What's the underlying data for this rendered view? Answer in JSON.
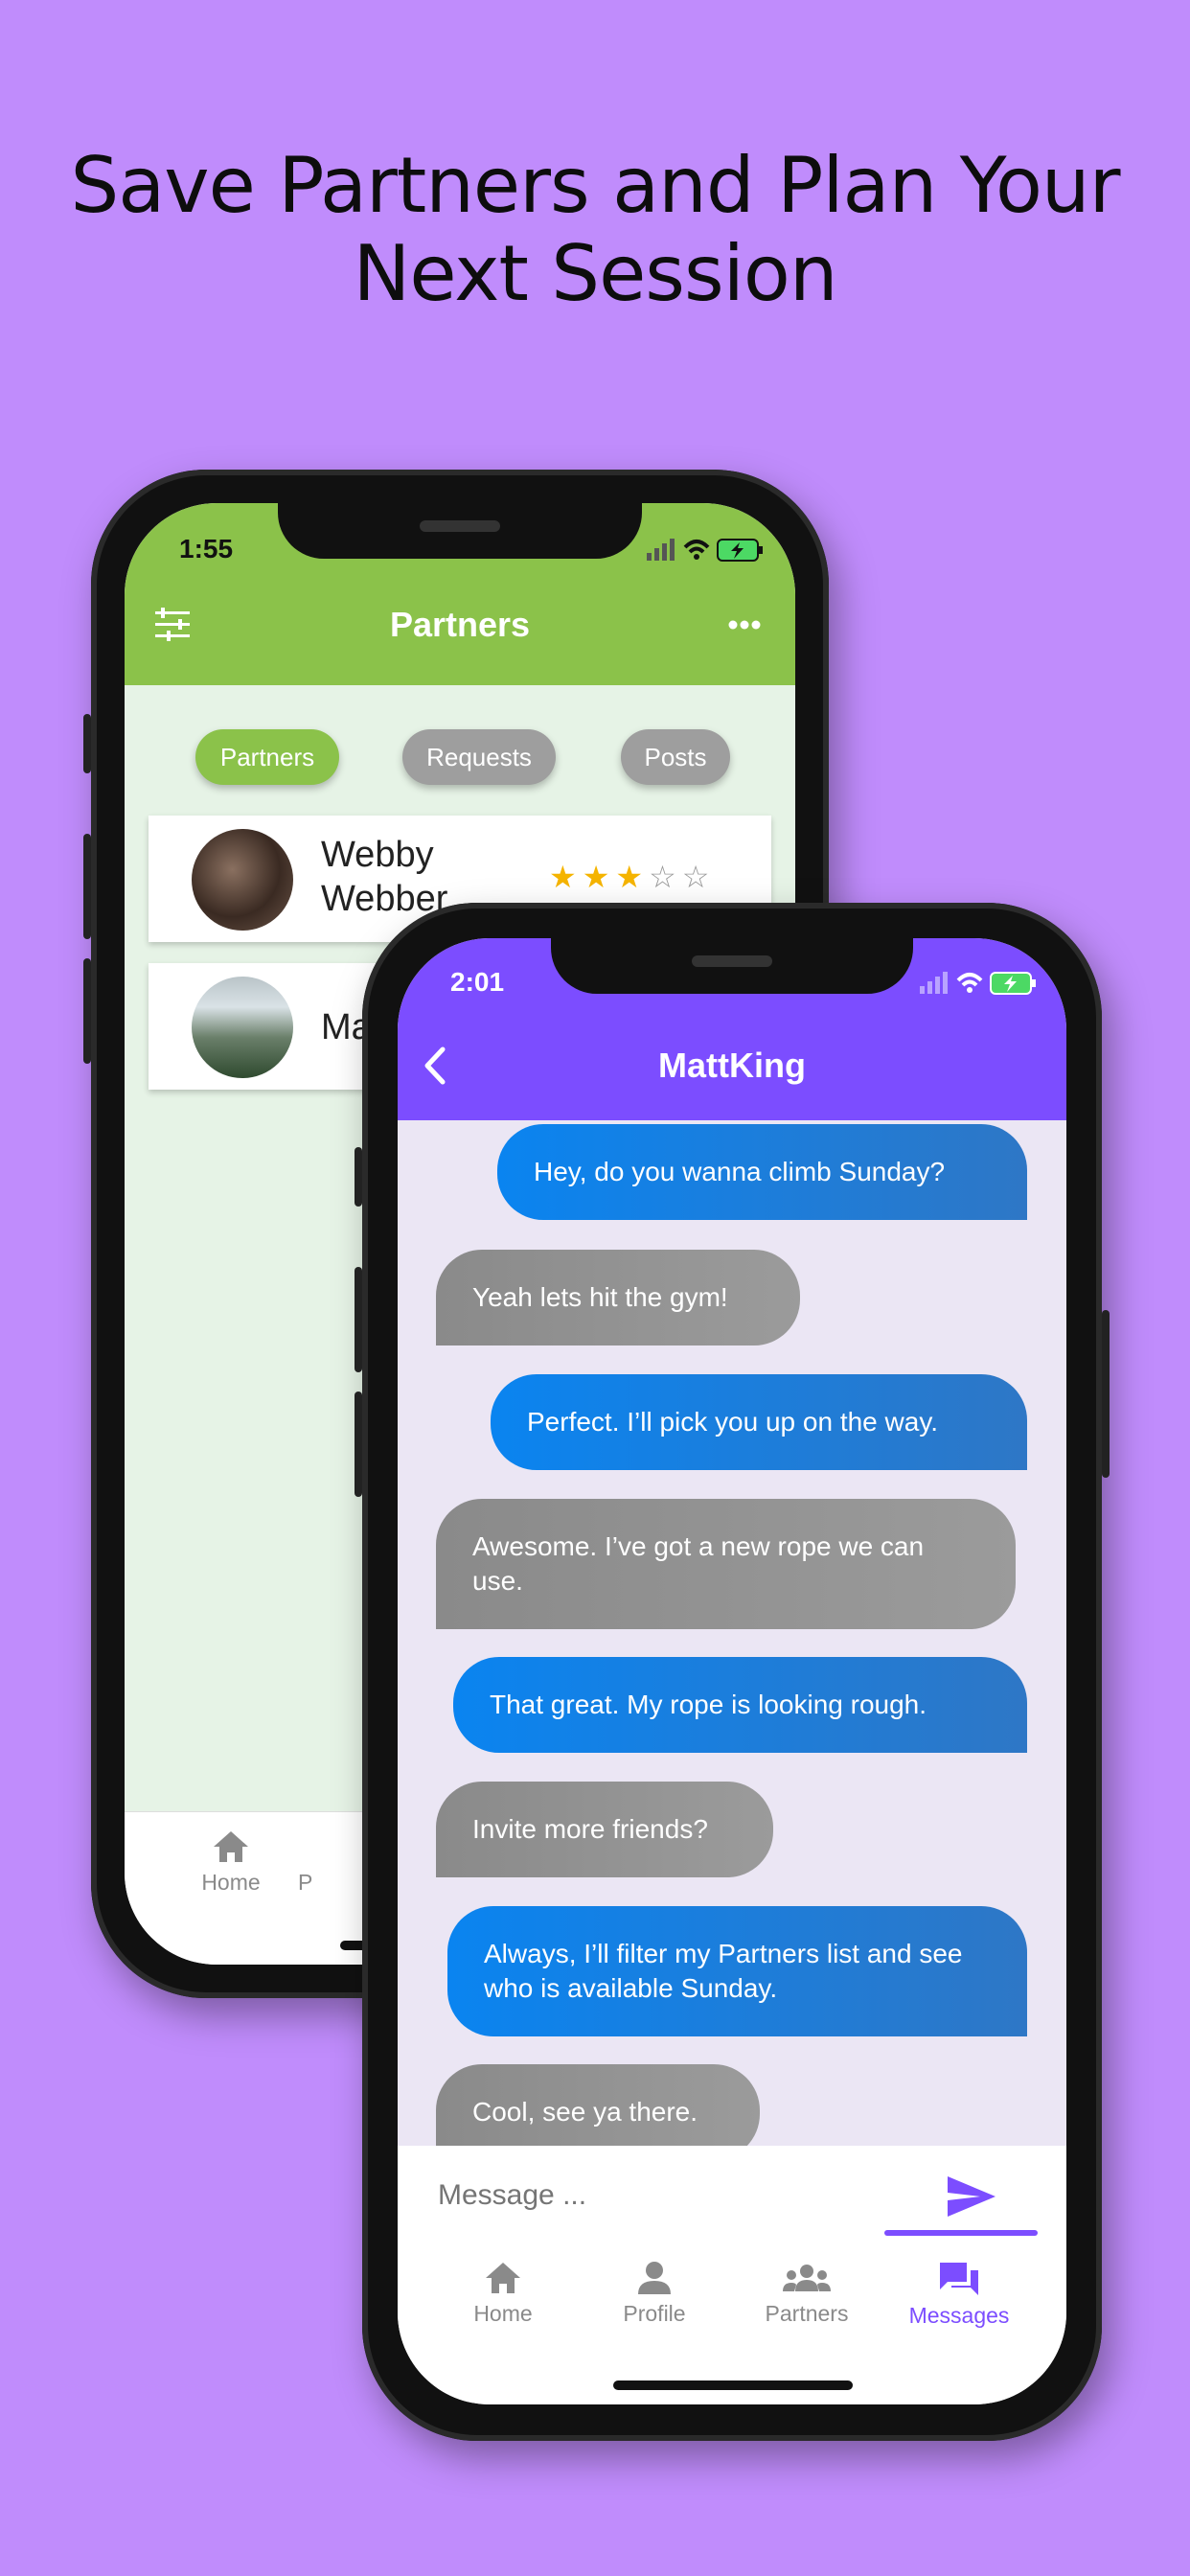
{
  "headline": {
    "line1": "Save Partners and Plan Your",
    "line2": "Next Session"
  },
  "partners_screen": {
    "status_time": "1:55",
    "title": "Partners",
    "filter_icon": "sliders-icon",
    "more_icon": "more-horizontal-icon",
    "tabs": [
      {
        "label": "Partners",
        "active": true
      },
      {
        "label": "Requests",
        "active": false
      },
      {
        "label": "Posts",
        "active": false
      }
    ],
    "partners": [
      {
        "name_line1": "Webby",
        "name_line2": "Webber",
        "rating": 3,
        "max_rating": 5
      },
      {
        "name_line1": "Ma",
        "name_line2": ""
      }
    ],
    "bottom_nav": [
      {
        "label": "Home",
        "icon": "home-icon"
      },
      {
        "label": "P",
        "icon": "profile-icon"
      }
    ],
    "colors": {
      "appbar": "#8bc24a",
      "background": "#e6f3e6",
      "tab_inactive": "#9e9e9e"
    }
  },
  "chat_screen": {
    "status_time": "2:01",
    "title": "MattKing",
    "back_icon": "chevron-left-icon",
    "messages": [
      {
        "from": "me",
        "text": "Hey, do you wanna climb Sunday?"
      },
      {
        "from": "them",
        "text": "Yeah lets hit the gym!"
      },
      {
        "from": "me",
        "text": "Perfect. I’ll pick you up on the way."
      },
      {
        "from": "them",
        "text": "Awesome. I’ve got a new rope we can use."
      },
      {
        "from": "me",
        "text": "That great. My rope is looking rough."
      },
      {
        "from": "them",
        "text": "Invite more friends?"
      },
      {
        "from": "me",
        "text": "Always, I’ll filter my Partners list and see who is available Sunday."
      },
      {
        "from": "them",
        "text": "Cool, see ya there."
      }
    ],
    "composer": {
      "placeholder": "Message ...",
      "send_icon": "send-icon"
    },
    "bottom_nav": [
      {
        "label": "Home",
        "icon": "home-icon",
        "active": false
      },
      {
        "label": "Profile",
        "icon": "profile-icon",
        "active": false
      },
      {
        "label": "Partners",
        "icon": "group-icon",
        "active": false
      },
      {
        "label": "Messages",
        "icon": "chat-icon",
        "active": true
      }
    ],
    "colors": {
      "appbar": "#7c4dff",
      "background": "#ebe6f4",
      "sent": "#0a84f0",
      "received": "#8a8a8a",
      "active_nav": "#7c4dff"
    }
  },
  "page_background": "#c08cfc"
}
